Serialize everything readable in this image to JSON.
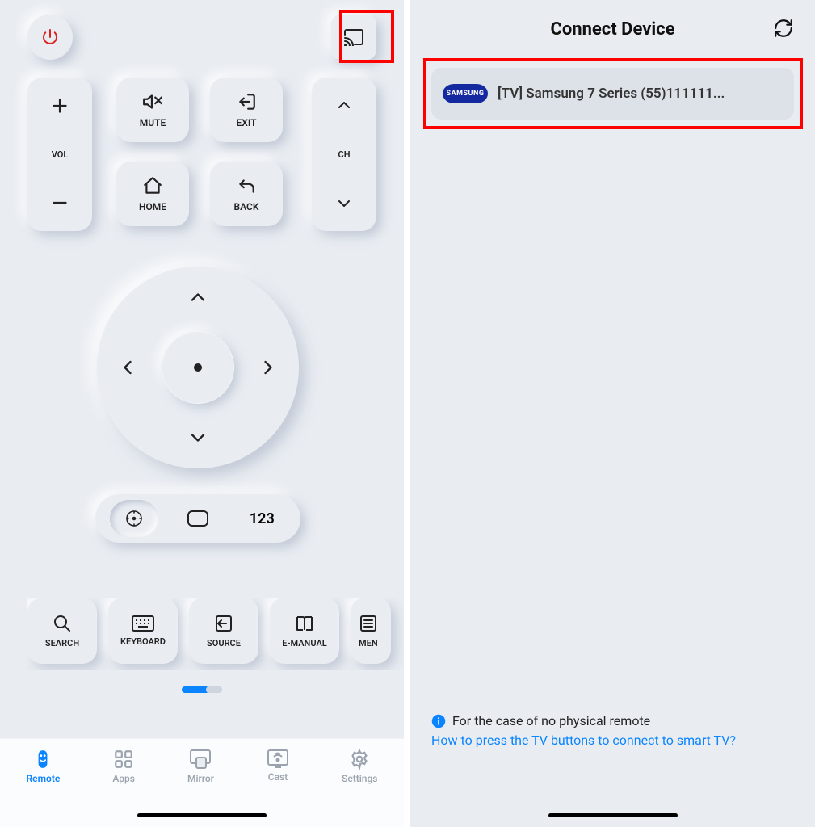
{
  "remote": {
    "vol_label": "VOL",
    "ch_label": "CH",
    "buttons": {
      "mute": "MUTE",
      "exit": "EXIT",
      "home": "HOME",
      "back": "BACK"
    },
    "mode_pill": {
      "numbers": "123"
    },
    "shortcuts": {
      "search": "SEARCH",
      "keyboard": "KEYBOARD",
      "source": "SOURCE",
      "emanual": "E-MANUAL",
      "menu": "MEN"
    },
    "nav": {
      "remote": "Remote",
      "apps": "Apps",
      "mirror": "Mirror",
      "cast": "Cast",
      "settings": "Settings"
    }
  },
  "connect": {
    "title": "Connect Device",
    "device_brand": "SAMSUNG",
    "device_name": "[TV] Samsung 7 Series (55)111111...",
    "info_text": "For the case of no physical remote",
    "help_link": "How to press the TV buttons to connect to smart TV?"
  }
}
